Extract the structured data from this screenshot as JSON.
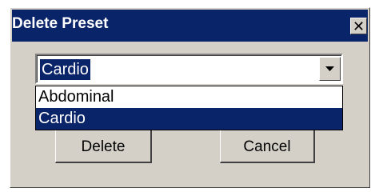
{
  "dialog": {
    "title": "Delete Preset",
    "close_glyph": "✕",
    "close_icon": "close-icon"
  },
  "combo": {
    "selected_value": "Cardio",
    "arrow_icon": "chevron-down-icon"
  },
  "dropdown": {
    "options": [
      "Abdominal",
      "Cardio"
    ],
    "highlighted_index": 1
  },
  "buttons": {
    "delete_label": "Delete",
    "cancel_label": "Cancel"
  },
  "colors": {
    "title_bar": "#0a246a",
    "face": "#d4d0c8",
    "highlight": "#0a246a"
  }
}
